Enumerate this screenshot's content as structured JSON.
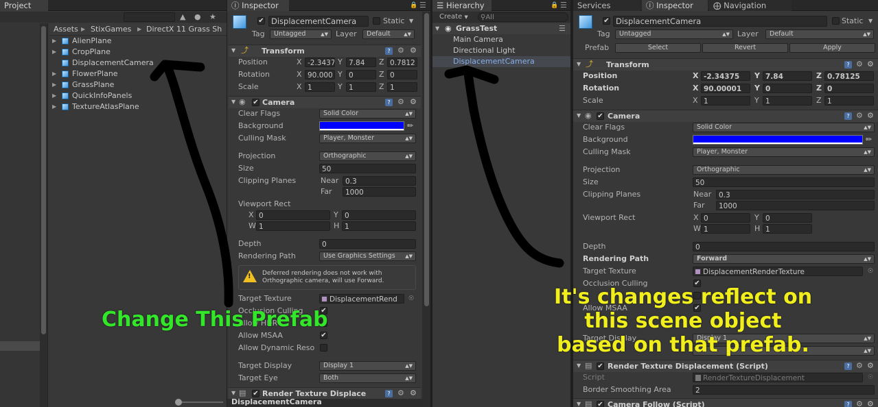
{
  "project_panel": {
    "tab": "Project",
    "breadcrumb": [
      "Assets",
      "StixGames",
      "DirectX 11 Grass Sh"
    ],
    "items": [
      "AlienPlane",
      "CropPlane",
      "DisplacementCamera",
      "FlowerPlane",
      "GrassPlane",
      "QuickInfoPanels",
      "TextureAtlasPlane"
    ]
  },
  "inspector_left": {
    "tab": "Inspector",
    "object_name": "DisplacementCamera",
    "static_label": "Static",
    "tag_label": "Tag",
    "tag_value": "Untagged",
    "layer_label": "Layer",
    "layer_value": "Default",
    "transform": {
      "title": "Transform",
      "position_label": "Position",
      "pos_x": "-2.3437",
      "pos_y": "7.84",
      "pos_z": "0.7812",
      "rotation_label": "Rotation",
      "rot_x": "90.000",
      "rot_y": "0",
      "rot_z": "0",
      "scale_label": "Scale",
      "scale_x": "1",
      "scale_y": "1",
      "scale_z": "1"
    },
    "camera": {
      "title": "Camera",
      "clear_flags_label": "Clear Flags",
      "clear_flags": "Solid Color",
      "background_label": "Background",
      "culling_mask_label": "Culling Mask",
      "culling_mask": "Player, Monster",
      "projection_label": "Projection",
      "projection": "Orthographic",
      "size_label": "Size",
      "size": "50",
      "clipping_label": "Clipping Planes",
      "near_label": "Near",
      "near": "0.3",
      "far_label": "Far",
      "far": "1000",
      "viewport_label": "Viewport Rect",
      "vx": "0",
      "vy": "0",
      "vw": "1",
      "vh": "1",
      "depth_label": "Depth",
      "depth": "0",
      "rendering_path_label": "Rendering Path",
      "rendering_path": "Use Graphics Settings",
      "warning": "Deferred rendering does not work with Orthographic camera, will use Forward.",
      "target_texture_label": "Target Texture",
      "target_texture": "DisplacementRend",
      "occlusion_label": "Occlusion Culling",
      "hdr_label": "Allow HDR",
      "msaa_label": "Allow MSAA",
      "dynres_label": "Allow Dynamic Reso",
      "target_display_label": "Target Display",
      "target_display": "Display 1",
      "target_eye_label": "Target Eye",
      "target_eye": "Both"
    },
    "render_tex_title": "Render Texture Displace",
    "footer_name": "DisplacementCamera"
  },
  "hierarchy": {
    "tab": "Hierarchy",
    "create_label": "Create",
    "search_placeholder": "All",
    "scene": "GrassTest",
    "items": [
      "Main Camera",
      "Directional Light",
      "DisplacementCamera"
    ]
  },
  "inspector_right": {
    "tabs": [
      "Services",
      "Inspector",
      "Navigation"
    ],
    "object_name": "DisplacementCamera",
    "static_label": "Static",
    "tag_label": "Tag",
    "tag_value": "Untagged",
    "layer_label": "Layer",
    "layer_value": "Default",
    "prefab_label": "Prefab",
    "select_label": "Select",
    "revert_label": "Revert",
    "apply_label": "Apply",
    "transform": {
      "title": "Transform",
      "position_label": "Position",
      "pos_x": "-2.34375",
      "pos_y": "7.84",
      "pos_z": "0.78125",
      "rotation_label": "Rotation",
      "rot_x": "90.00001",
      "rot_y": "0",
      "rot_z": "0",
      "scale_label": "Scale",
      "scale_x": "1",
      "scale_y": "1",
      "scale_z": "1"
    },
    "camera": {
      "title": "Camera",
      "clear_flags_label": "Clear Flags",
      "clear_flags": "Solid Color",
      "background_label": "Background",
      "culling_mask_label": "Culling Mask",
      "culling_mask": "Player, Monster",
      "projection_label": "Projection",
      "projection": "Orthographic",
      "size_label": "Size",
      "size": "50",
      "clipping_label": "Clipping Planes",
      "near_label": "Near",
      "near": "0.3",
      "far_label": "Far",
      "far": "1000",
      "viewport_label": "Viewport Rect",
      "vx": "0",
      "vy": "0",
      "vw": "1",
      "vh": "1",
      "depth_label": "Depth",
      "depth": "0",
      "rendering_path_label": "Rendering Path",
      "rendering_path": "Forward",
      "target_texture_label": "Target Texture",
      "target_texture": "DisplacementRenderTexture",
      "occlusion_label": "Occlusion Culling",
      "msaa_label": "Allow MSAA",
      "target_display_label": "Target Display",
      "target_display": "Display 1"
    },
    "render_tex": {
      "title": "Render Texture Displacement (Script)",
      "script_label": "Script",
      "script_value": "RenderTextureDisplacement",
      "border_label": "Border Smoothing Area",
      "border_value": "2"
    },
    "camera_follow_title": "Camera Follow (Script)"
  },
  "annotations": {
    "left": "Change This Prefab",
    "right_line1": "It's changes reflect on",
    "right_line2": "this scene object",
    "right_line3": "based on that prefab."
  },
  "colors": {
    "background_swatch": "#0000ff",
    "annot_green": "#33e62a",
    "annot_yellow": "#f0ee1c"
  }
}
